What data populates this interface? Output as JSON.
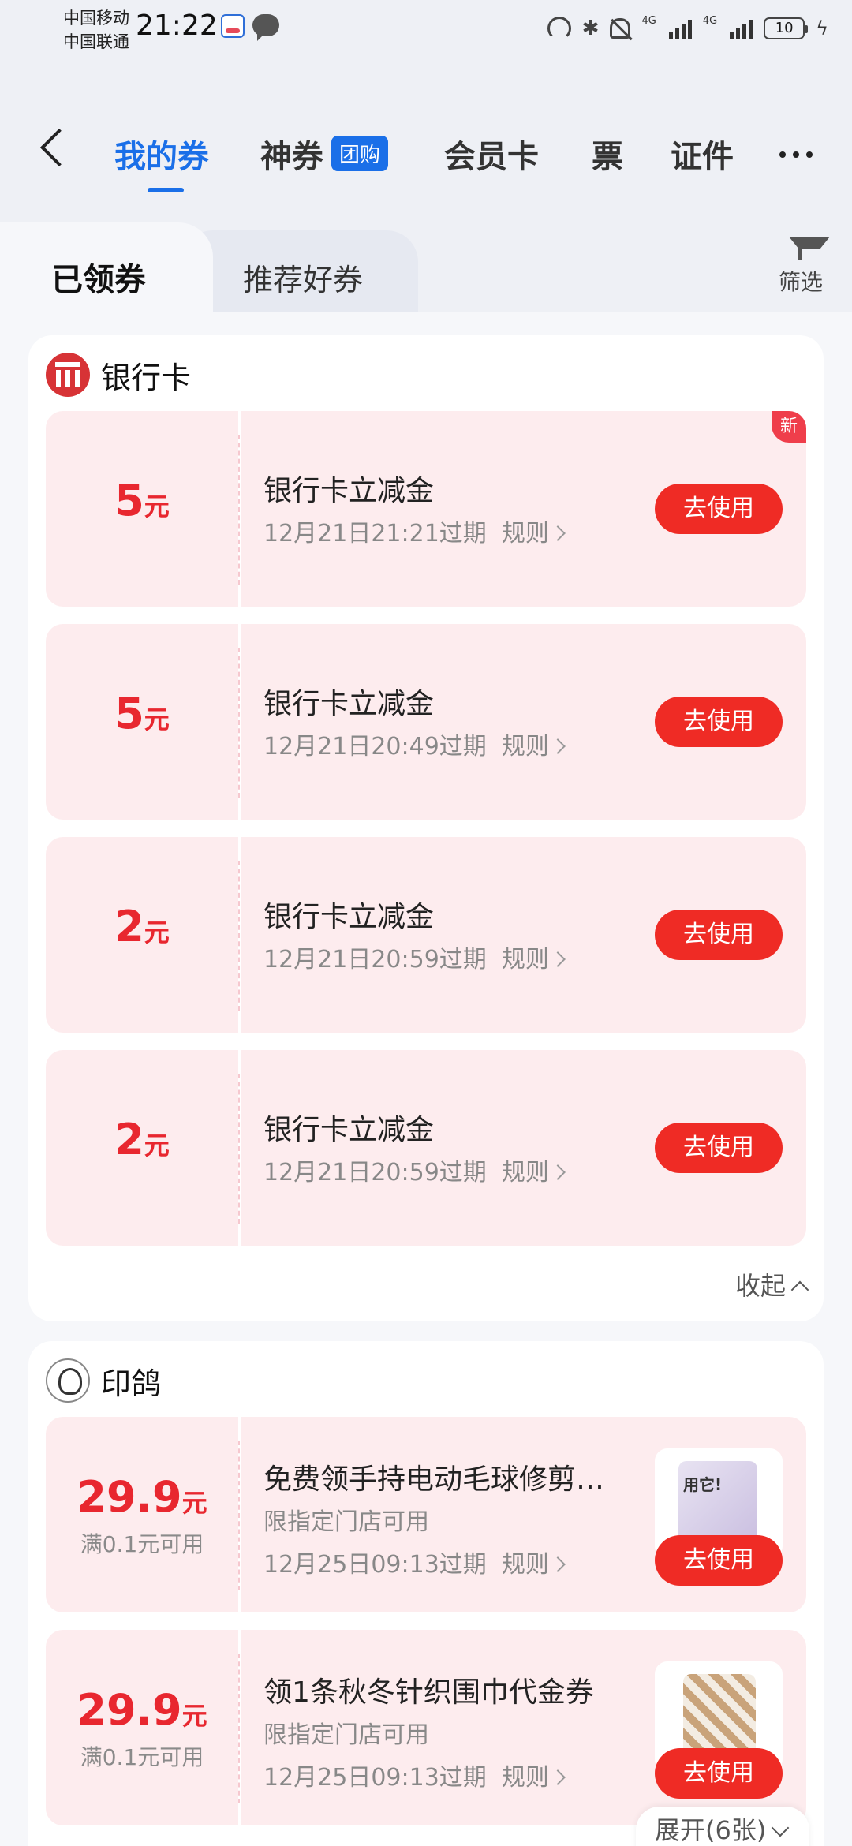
{
  "status_bar": {
    "carrier1": "中国移动",
    "carrier2": "中国联通",
    "time": "21:22",
    "signal1_label": "4G",
    "signal2_label": "4G",
    "battery": "10"
  },
  "header": {
    "tabs": {
      "my_coupons": "我的券",
      "super_coupons": "神券",
      "group_buy_badge": "团购",
      "member_card": "会员卡",
      "ticket": "票",
      "certificate": "证件"
    }
  },
  "segment": {
    "received": "已领券",
    "recommended": "推荐好券",
    "filter": "筛选"
  },
  "bank_card_section": {
    "title": "银行卡",
    "coupons": [
      {
        "amount": "5",
        "unit": "元",
        "title": "银行卡立减金",
        "expire": "12月21日21:21过期",
        "rule": "规则",
        "button": "去使用",
        "badge": "新"
      },
      {
        "amount": "5",
        "unit": "元",
        "title": "银行卡立减金",
        "expire": "12月21日20:49过期",
        "rule": "规则",
        "button": "去使用"
      },
      {
        "amount": "2",
        "unit": "元",
        "title": "银行卡立减金",
        "expire": "12月21日20:59过期",
        "rule": "规则",
        "button": "去使用"
      },
      {
        "amount": "2",
        "unit": "元",
        "title": "银行卡立减金",
        "expire": "12月21日20:59过期",
        "rule": "规则",
        "button": "去使用"
      }
    ],
    "collapse": "收起"
  },
  "yinge_section": {
    "title": "印鸽",
    "coupons": [
      {
        "amount": "29.9",
        "unit": "元",
        "condition": "满0.1元可用",
        "title": "免费领手持电动毛球修剪…",
        "limit": "限指定门店可用",
        "expire": "12月25日09:13过期",
        "rule": "规则",
        "button": "去使用"
      },
      {
        "amount": "29.9",
        "unit": "元",
        "condition": "满0.1元可用",
        "title": "领1条秋冬针织围巾代金券",
        "limit": "限指定门店可用",
        "expire": "12月25日09:13过期",
        "rule": "规则",
        "button": "去使用"
      }
    ],
    "expand": "展开(6张)"
  }
}
